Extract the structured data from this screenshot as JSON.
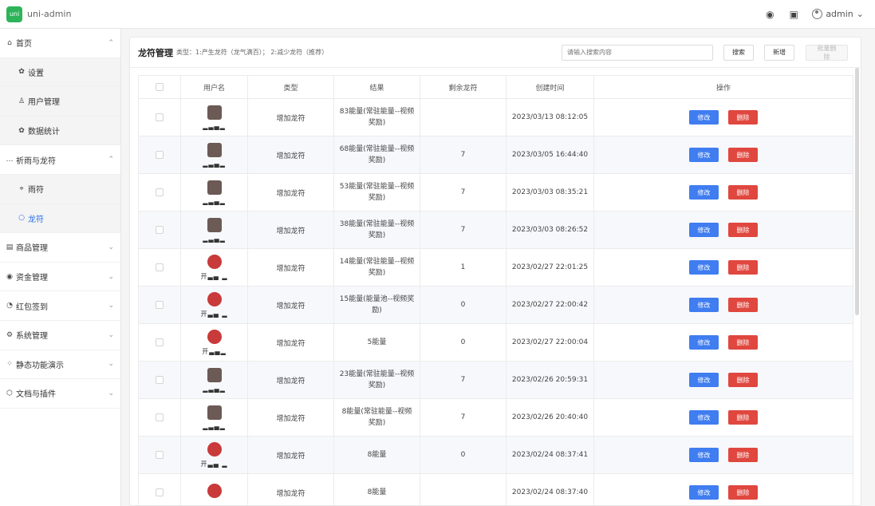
{
  "app": {
    "logo_text": "uni",
    "title": "uni-admin"
  },
  "topbar": {
    "theme_icon": "palette-icon",
    "lang_icon": "translate-icon",
    "user": "admin"
  },
  "sidebar": {
    "items": [
      {
        "label": "首页",
        "icon": "home-icon",
        "level": 1,
        "chevron": "⌃"
      },
      {
        "label": "设置",
        "icon": "gear-icon",
        "level": 2
      },
      {
        "label": "用户管理",
        "icon": "user-icon",
        "level": 2
      },
      {
        "label": "数据统计",
        "icon": "gear-icon",
        "level": 2
      },
      {
        "label": "祈雨与龙符",
        "icon": "more-icon",
        "level": 1,
        "chevron": "⌃"
      },
      {
        "label": "雨符",
        "icon": "pin-icon",
        "level": 2
      },
      {
        "label": "龙符",
        "icon": "circle-icon",
        "level": 2,
        "active": true
      },
      {
        "label": "商品管理",
        "icon": "shop-icon",
        "level": 1,
        "chevron": "⌄"
      },
      {
        "label": "资金管理",
        "icon": "eye-icon",
        "level": 1,
        "chevron": "⌄"
      },
      {
        "label": "红包签到",
        "icon": "clock-icon",
        "level": 1,
        "chevron": "⌄"
      },
      {
        "label": "系统管理",
        "icon": "settings-icon",
        "level": 1,
        "chevron": "⌄"
      },
      {
        "label": "静态功能演示",
        "icon": "grid-icon",
        "level": 1,
        "chevron": "⌄"
      },
      {
        "label": "文档与插件",
        "icon": "box-icon",
        "level": 1,
        "chevron": "⌄"
      }
    ]
  },
  "page": {
    "title": "龙符管理",
    "desc": "类型：1:产生龙符（龙气满百）； 2:减少龙符（推荐）",
    "search_placeholder": "请输入搜索内容",
    "search_label": "搜索",
    "add_label": "新增",
    "batch_delete_label": "批量删除"
  },
  "table": {
    "headers": [
      "",
      "用户名",
      "类型",
      "结果",
      "剩余龙符",
      "创建时间",
      "操作"
    ],
    "edit_label": "修改",
    "delete_label": "删除",
    "rows": [
      {
        "avatar": "photo",
        "name": "▂▃▄▂",
        "type": "增加龙符",
        "result": "83能量(常驻能量--视频奖励)",
        "remain": "",
        "time": "2023/03/13 08:12:05"
      },
      {
        "avatar": "photo",
        "name": "▂▃▄▂",
        "type": "增加龙符",
        "result": "68能量(常驻能量--视频奖励)",
        "remain": "7",
        "time": "2023/03/05 16:44:40"
      },
      {
        "avatar": "photo",
        "name": "▂▃▄▂",
        "type": "增加龙符",
        "result": "53能量(常驻能量--视频奖励)",
        "remain": "7",
        "time": "2023/03/03 08:35:21"
      },
      {
        "avatar": "photo",
        "name": "▂▃▄▂",
        "type": "增加龙符",
        "result": "38能量(常驻能量--视频奖励)",
        "remain": "7",
        "time": "2023/03/03 08:26:52"
      },
      {
        "avatar": "red",
        "name": "开▃▄ ▂",
        "type": "增加龙符",
        "result": "14能量(常驻能量--视频奖励)",
        "remain": "1",
        "time": "2023/02/27 22:01:25"
      },
      {
        "avatar": "red",
        "name": "开▃▄ ▂",
        "type": "增加龙符",
        "result": "15能量(能量池--视频奖励)",
        "remain": "0",
        "time": "2023/02/27 22:00:42"
      },
      {
        "avatar": "red",
        "name": "开▃▄▂",
        "type": "增加龙符",
        "result": "5能量",
        "remain": "0",
        "time": "2023/02/27 22:00:04"
      },
      {
        "avatar": "photo",
        "name": "▂▃▄▂",
        "type": "增加龙符",
        "result": "23能量(常驻能量--视频奖励)",
        "remain": "7",
        "time": "2023/02/26 20:59:31"
      },
      {
        "avatar": "photo",
        "name": "▂▃▄▂",
        "type": "增加龙符",
        "result": "8能量(常驻能量--视频奖励)",
        "remain": "7",
        "time": "2023/02/26 20:40:40"
      },
      {
        "avatar": "red",
        "name": "开▃▄ ▂",
        "type": "增加龙符",
        "result": "8能量",
        "remain": "0",
        "time": "2023/02/24 08:37:41"
      },
      {
        "avatar": "red",
        "name": "",
        "type": "增加龙符",
        "result": "8能量",
        "remain": "",
        "time": "2023/02/24 08:37:40"
      }
    ]
  },
  "colors": {
    "primary": "#3f7df0",
    "danger": "#e0473f",
    "brand": "#2db45a",
    "active": "#2a6fe8"
  }
}
